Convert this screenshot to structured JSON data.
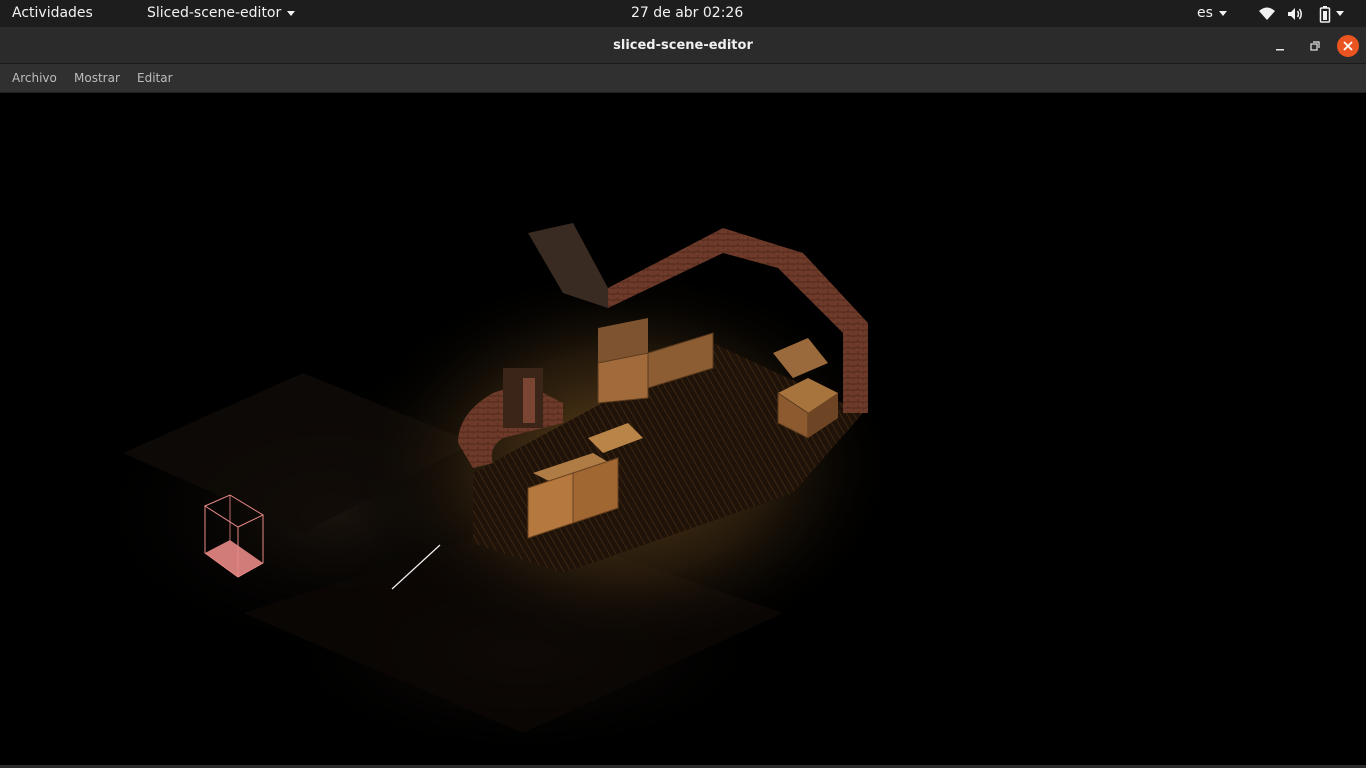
{
  "topbar": {
    "activities_label": "Actividades",
    "app_menu_label": "Sliced-scene-editor",
    "clock": "27 de abr  02:26",
    "keyboard_layout": "es",
    "icons": [
      "wifi-icon",
      "volume-icon",
      "battery-icon",
      "system-menu-caret-icon"
    ]
  },
  "window": {
    "title": "sliced-scene-editor",
    "controls": [
      "minimize-icon",
      "maximize-icon",
      "close-icon"
    ],
    "close_color": "#e95420"
  },
  "menubar": {
    "items": [
      "Archivo",
      "Mostrar",
      "Editar"
    ]
  },
  "viewport": {
    "background": "#000000",
    "scene_content": [
      "isometric-brick-room",
      "wooden-crates",
      "light-selection-cube",
      "white-line-gizmo"
    ],
    "selection_color": "#e88a86"
  }
}
